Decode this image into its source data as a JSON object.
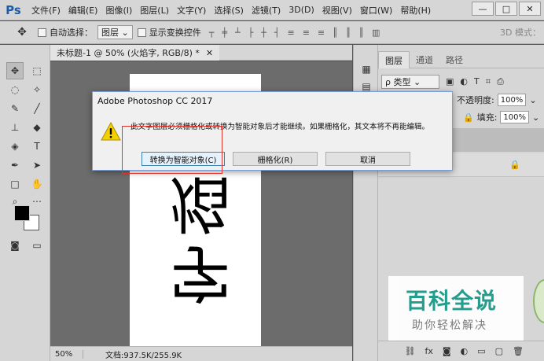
{
  "menubar": {
    "logo": "Ps",
    "items": [
      "文件(F)",
      "编辑(E)",
      "图像(I)",
      "图层(L)",
      "文字(Y)",
      "选择(S)",
      "滤镜(T)",
      "3D(D)",
      "视图(V)",
      "窗口(W)",
      "帮助(H)"
    ],
    "minimize": "—",
    "restore": "□",
    "close": "✕"
  },
  "options": {
    "auto_select_label": "自动选择：",
    "auto_select_value": "图层",
    "show_transform_label": "显示变换控件",
    "mode_3d": "3D 模式："
  },
  "document": {
    "tab_title": "未标题-1 @ 50% (火焰字, RGB/8) *",
    "close_glyph": "✕",
    "canvas_text": [
      "焰",
      "字"
    ],
    "zoom": "50%",
    "doc_info": "文档:937.5K/255.9K"
  },
  "layers": {
    "tabs": [
      "图层",
      "通道",
      "路径"
    ],
    "kind_filter": "ρ 类型",
    "opacity_label": "不透明度:",
    "opacity_value": "100%",
    "fill_label": "填充:",
    "fill_value": "100%"
  },
  "dialog": {
    "title": "Adobe Photoshop CC 2017",
    "message": "此文字图层必须栅格化或转换为智能对象后才能继续。如果栅格化，其文本将不再能编辑。",
    "convert_button": "转换为智能对象(C)",
    "rasterize_button": "栅格化(R)",
    "cancel_button": "取消"
  },
  "watermark": {
    "title": "百科全说",
    "subtitle": "助你轻松解决"
  },
  "colors": {
    "accent": "#1b9a8a",
    "highlight": "#e0342c",
    "warning": "#f5d000"
  }
}
